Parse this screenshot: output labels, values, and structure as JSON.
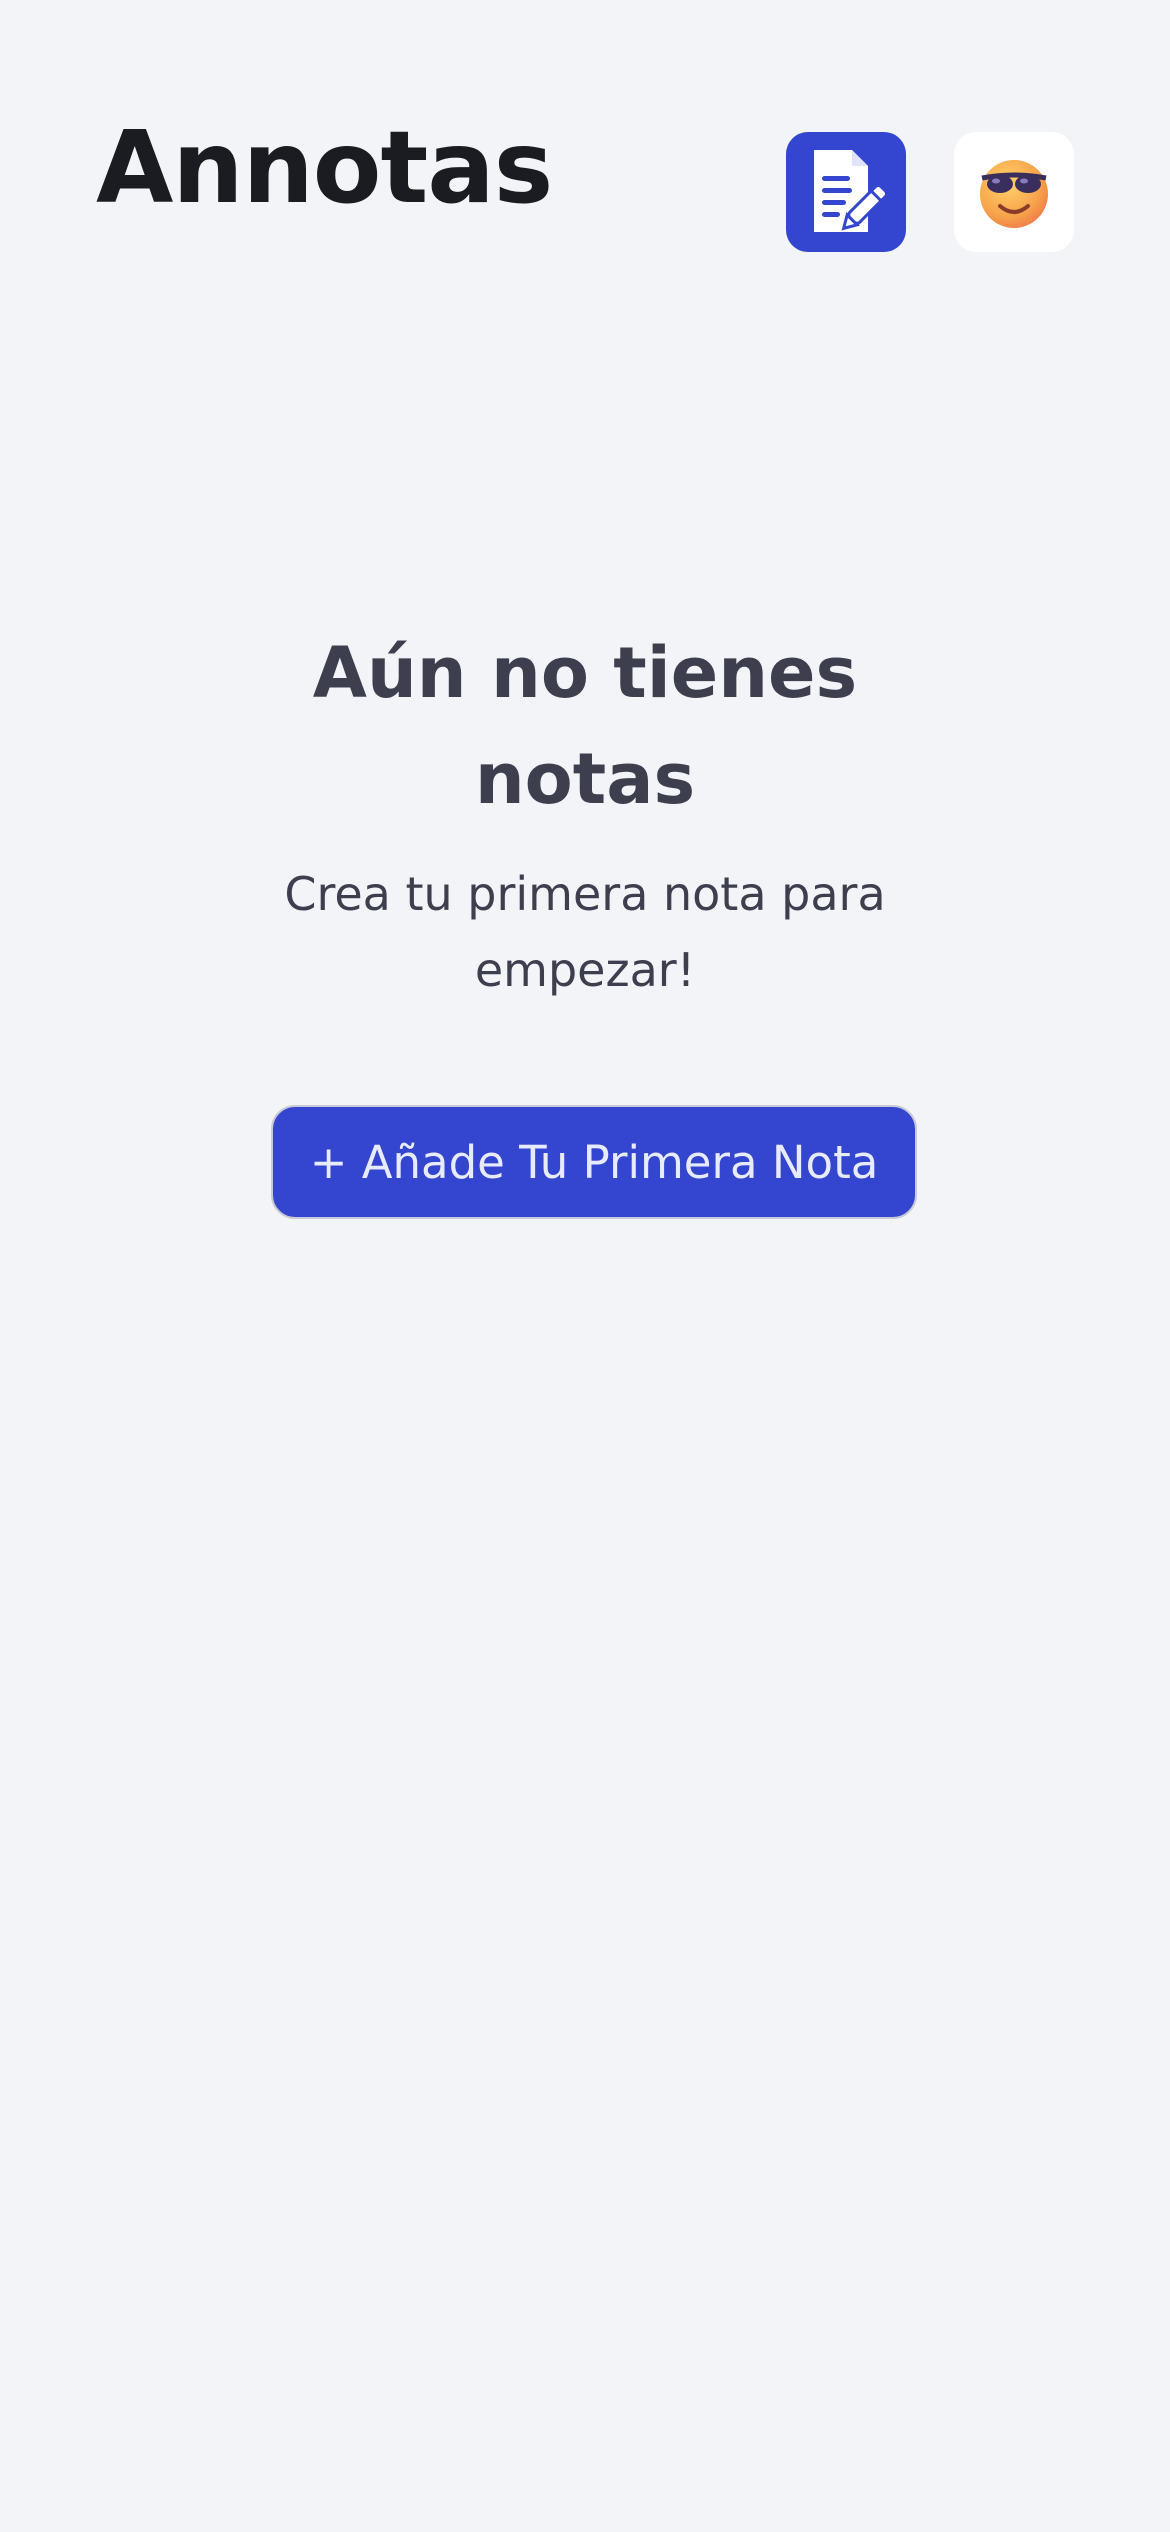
{
  "header": {
    "title": "Annotas",
    "notes_icon": "note-edit-icon",
    "profile_icon": "cool-face-emoji-icon"
  },
  "empty_state": {
    "title": "Aún no tienes notas",
    "subtitle": "Crea tu primera nota para empezar!",
    "add_button_label": "+ Añade Tu Primera Nota"
  },
  "colors": {
    "background": "#f3f4f8",
    "accent": "#3446cf",
    "title_text": "#1b1b22",
    "body_text": "#3d3f4f"
  }
}
